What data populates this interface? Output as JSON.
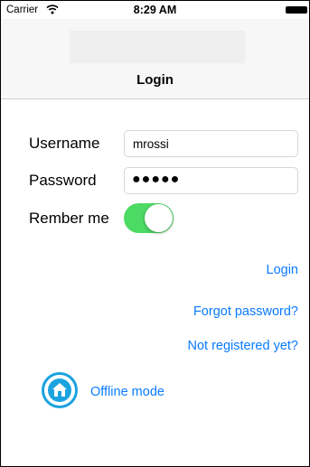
{
  "status_bar": {
    "carrier": "Carrier",
    "time": "8:29 AM",
    "wifi_icon": "wifi-icon",
    "battery_icon": "battery-icon"
  },
  "nav": {
    "title": "Login"
  },
  "form": {
    "username_label": "Username",
    "username_value": "mrossi",
    "password_label": "Password",
    "password_value": "●●●●●",
    "remember_label": "Rember me",
    "remember_on": true
  },
  "actions": {
    "login": "Login",
    "forgot": "Forgot password?",
    "register": "Not registered yet?",
    "offline": "Offline mode",
    "offline_icon": "home-icon"
  },
  "colors": {
    "accent": "#0a7aff",
    "toggle_on": "#4cd964",
    "home_icon": "#1aa3df"
  }
}
